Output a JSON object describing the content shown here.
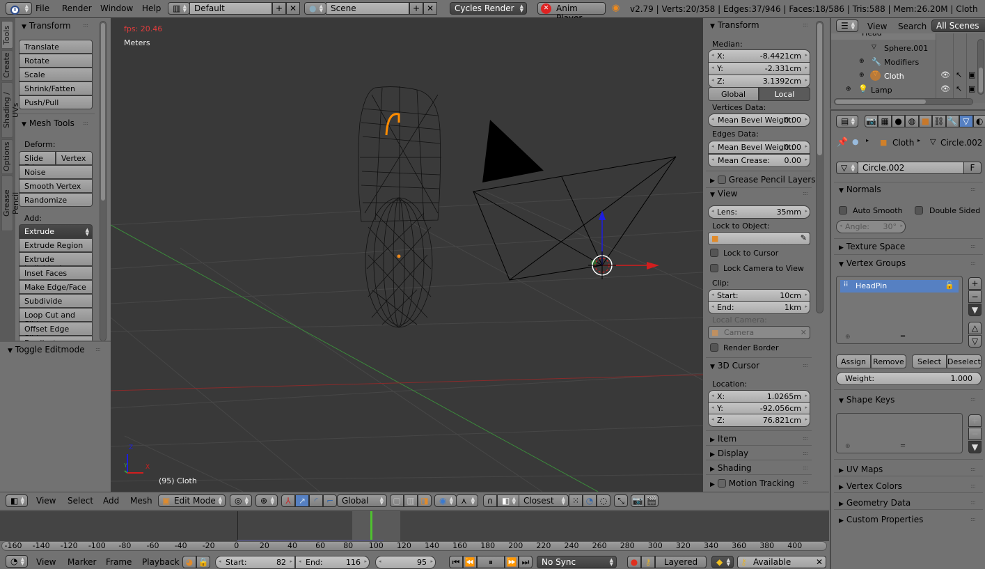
{
  "topbar": {
    "info_icon": "info-icon",
    "menus": [
      "File",
      "Render",
      "Window",
      "Help"
    ],
    "layout": {
      "icon": "screen-layout-icon",
      "value": "Default"
    },
    "scene": {
      "icon": "scene-icon",
      "value": "Scene"
    },
    "render_engine": "Cycles Render",
    "anim_player": "Anim Player",
    "stats": "v2.79 | Verts:20/358 | Edges:37/946 | Faces:18/586 | Tris:588 | Mem:26.20M | Cloth"
  },
  "tool_tabs": [
    "Tools",
    "Create",
    "Shading / UVs",
    "Options",
    "Grease Pencil"
  ],
  "tools": {
    "transform": {
      "title": "Transform",
      "buttons": [
        "Translate",
        "Rotate",
        "Scale",
        "Shrink/Fatten",
        "Push/Pull"
      ]
    },
    "mesh_tools": {
      "title": "Mesh Tools",
      "deform_label": "Deform:",
      "deform_row": [
        "Slide Ed",
        "Vertex"
      ],
      "deform_buttons": [
        "Noise",
        "Smooth Vertex",
        "Randomize"
      ],
      "add_label": "Add:",
      "extrude_select": "Extrude",
      "add_buttons": [
        "Extrude Region",
        "Extrude Individual",
        "Inset Faces",
        "Make Edge/Face",
        "Subdivide",
        "Loop Cut and Slide",
        "Offset Edge Slide",
        "Duplicate"
      ]
    },
    "operator_panel": "Toggle Editmode"
  },
  "viewport": {
    "fps": "fps: 20.46",
    "units": "Meters",
    "object_label": "(95) Cloth",
    "axis_labels": {
      "x": "X",
      "y": "Y",
      "z": "Z"
    },
    "colors": {
      "fps": "#e03c3c",
      "selected": "#ff8c00",
      "x_axis": "#d21e1e",
      "y_axis": "#3c9a3c",
      "z_axis": "#1e1ed2"
    }
  },
  "properties_n": {
    "transform": {
      "title": "Transform",
      "median_label": "Median:",
      "fields": [
        {
          "label": "X:",
          "value": "-8.4421cm"
        },
        {
          "label": "Y:",
          "value": "-2.331cm"
        },
        {
          "label": "Z:",
          "value": "3.1392cm"
        }
      ],
      "space_toggle": [
        "Global",
        "Local"
      ],
      "space_active": "Local",
      "vertices_label": "Vertices Data:",
      "vert_bevel": {
        "label": "Mean Bevel Weight:",
        "value": "0.00"
      },
      "edges_label": "Edges Data:",
      "edge_bevel": {
        "label": "Mean Bevel Weight:",
        "value": "0.00"
      },
      "edge_crease": {
        "label": "Mean Crease:",
        "value": "0.00"
      }
    },
    "grease_pencil": "Grease Pencil Layers",
    "view": {
      "title": "View",
      "lens": {
        "label": "Lens:",
        "value": "35mm"
      },
      "lock_object_label": "Lock to Object:",
      "lock_cursor": "Lock to Cursor",
      "lock_camera": "Lock Camera to View",
      "clip_label": "Clip:",
      "clip_start": {
        "label": "Start:",
        "value": "10cm"
      },
      "clip_end": {
        "label": "End:",
        "value": "1km"
      },
      "local_camera_label": "Local Camera:",
      "local_camera_value": "Camera",
      "render_border": "Render Border"
    },
    "cursor": {
      "title": "3D Cursor",
      "location_label": "Location:",
      "fields": [
        {
          "label": "X:",
          "value": "1.0265m"
        },
        {
          "label": "Y:",
          "value": "-92.056cm"
        },
        {
          "label": "Z:",
          "value": "76.821cm"
        }
      ]
    },
    "collapsed": [
      "Item",
      "Display",
      "Shading"
    ],
    "motion_tracking": "Motion Tracking"
  },
  "outliner": {
    "menus": [
      "View",
      "Search"
    ],
    "filter": "All Scenes",
    "items": [
      {
        "name": "Head",
        "icon": "mesh-object-icon"
      },
      {
        "name": "Sphere.001",
        "icon": "mesh-data-icon"
      },
      {
        "name": "Modifiers",
        "icon": "wrench-icon"
      },
      {
        "name": "Cloth",
        "icon": "mesh-data-icon"
      },
      {
        "name": "Lamp",
        "icon": "lamp-icon"
      }
    ]
  },
  "properties": {
    "breadcrumb": [
      "Cloth",
      "Circle.002"
    ],
    "datablock": "Circle.002",
    "fake_user": "F",
    "normals": {
      "title": "Normals",
      "auto_smooth": "Auto Smooth",
      "double_sided": "Double Sided",
      "angle": {
        "label": "Angle:",
        "value": "30°"
      }
    },
    "texture_space": "Texture Space",
    "vertex_groups": {
      "title": "Vertex Groups",
      "items": [
        "HeadPin"
      ],
      "buttons": [
        "Assign",
        "Remove",
        "Select",
        "Deselect"
      ],
      "weight": {
        "label": "Weight:",
        "value": "1.000"
      }
    },
    "shape_keys": "Shape Keys",
    "collapsed": [
      "UV Maps",
      "Vertex Colors",
      "Geometry Data",
      "Custom Properties"
    ],
    "accent": "#5680c2"
  },
  "view3d_header": {
    "menus": [
      "View",
      "Select",
      "Add",
      "Mesh"
    ],
    "mode": "Edit Mode",
    "orientation": "Global",
    "snap_target": "Closest"
  },
  "timeline": {
    "ruler": [
      "-160",
      "-140",
      "-120",
      "-100",
      "-80",
      "-60",
      "-40",
      "-20",
      "0",
      "20",
      "40",
      "60",
      "80",
      "100",
      "120",
      "140",
      "160",
      "180",
      "200",
      "220",
      "240",
      "260",
      "280",
      "300",
      "320",
      "340",
      "360",
      "380",
      "400"
    ],
    "menus": [
      "View",
      "Marker",
      "Frame",
      "Playback"
    ],
    "start": {
      "label": "Start:",
      "value": "82"
    },
    "end": {
      "label": "End:",
      "value": "116"
    },
    "current": "95",
    "sync": "No Sync",
    "keying": "Layered",
    "keyset": "Available",
    "colors": {
      "playhead": "#4fc22f"
    }
  }
}
